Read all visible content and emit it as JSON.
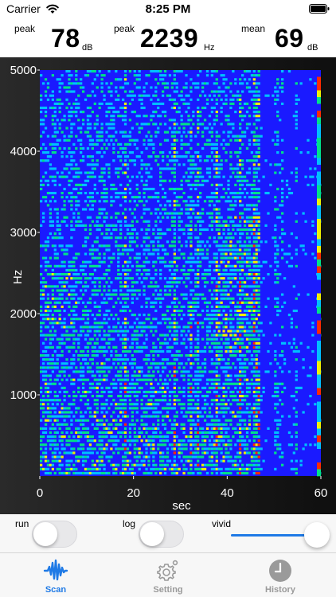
{
  "status_bar": {
    "carrier": "Carrier",
    "time": "8:25 PM",
    "wifi_icon": "wifi-icon",
    "battery_icon": "battery-full-icon"
  },
  "readouts": {
    "peak_level": {
      "label": "peak",
      "value": "78",
      "unit": "dB"
    },
    "peak_freq": {
      "label": "peak",
      "value": "2239",
      "unit": "Hz"
    },
    "mean_level": {
      "label": "mean",
      "value": "69",
      "unit": "dB"
    }
  },
  "chart_data": {
    "type": "heatmap",
    "title": "",
    "xlabel": "sec",
    "ylabel": "Hz",
    "xlim": [
      0,
      60
    ],
    "ylim": [
      0,
      5000
    ],
    "x_ticks": [
      "0",
      "20",
      "40",
      "60"
    ],
    "y_ticks": [
      "1000",
      "2000",
      "3000",
      "4000",
      "5000"
    ],
    "colormap": [
      "#1a1aff",
      "#00bfff",
      "#00e08a",
      "#f0f000",
      "#ff2a00"
    ],
    "colorbar_ticks": []
  },
  "controls": {
    "run": {
      "label": "run",
      "on": false
    },
    "log": {
      "label": "log",
      "on": false
    },
    "vivid": {
      "label": "vivid",
      "level": 1.0
    },
    "accent_color": "#1f7ae6"
  },
  "tabs": [
    {
      "label": "Scan",
      "icon": "waveform-icon",
      "active": true,
      "color": "#1f7ae6"
    },
    {
      "label": "Setting",
      "icon": "gear-icon",
      "active": false,
      "color": "#9a9a9a"
    },
    {
      "label": "History",
      "icon": "clock-icon",
      "active": false,
      "color": "#9a9a9a"
    }
  ]
}
